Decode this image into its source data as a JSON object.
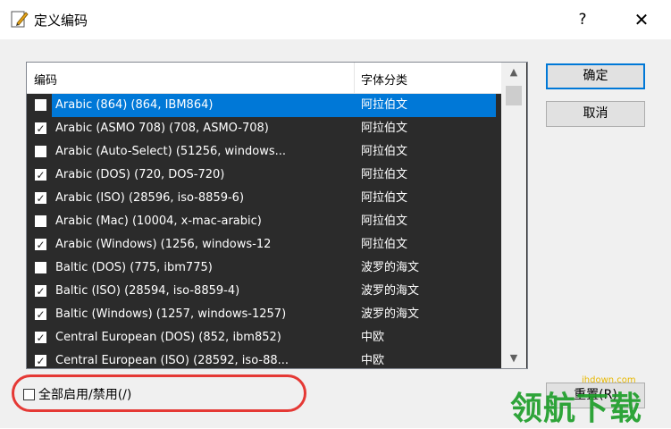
{
  "window": {
    "title": "定义编码",
    "help_label": "?",
    "close_label": "✕",
    "icon": "edit-document-icon"
  },
  "list": {
    "header": {
      "encoding": "编码",
      "category": "字体分类"
    },
    "rows": [
      {
        "label": "Arabic (864) (864, IBM864)",
        "category": "阿拉伯文",
        "checked": false,
        "selected": true
      },
      {
        "label": "Arabic (ASMO 708) (708, ASMO-708)",
        "category": "阿拉伯文",
        "checked": true,
        "selected": false
      },
      {
        "label": "Arabic (Auto-Select) (51256, windows...",
        "category": "阿拉伯文",
        "checked": false,
        "selected": false
      },
      {
        "label": "Arabic (DOS) (720, DOS-720)",
        "category": "阿拉伯文",
        "checked": true,
        "selected": false
      },
      {
        "label": "Arabic (ISO) (28596, iso-8859-6)",
        "category": "阿拉伯文",
        "checked": true,
        "selected": false
      },
      {
        "label": "Arabic (Mac) (10004, x-mac-arabic)",
        "category": "阿拉伯文",
        "checked": false,
        "selected": false
      },
      {
        "label": "Arabic (Windows) (1256, windows-12",
        "category": "阿拉伯文",
        "checked": true,
        "selected": false
      },
      {
        "label": "Baltic (DOS) (775, ibm775)",
        "category": "波罗的海文",
        "checked": false,
        "selected": false
      },
      {
        "label": "Baltic (ISO) (28594, iso-8859-4)",
        "category": "波罗的海文",
        "checked": true,
        "selected": false
      },
      {
        "label": "Baltic (Windows) (1257, windows-1257)",
        "category": "波罗的海文",
        "checked": true,
        "selected": false
      },
      {
        "label": "Central European (DOS) (852, ibm852)",
        "category": "中欧",
        "checked": true,
        "selected": false
      },
      {
        "label": "Central European (ISO) (28592, iso-88...",
        "category": "中欧",
        "checked": true,
        "selected": false
      }
    ],
    "scroll_up_icon": "chevron-up-icon",
    "scroll_down_icon": "chevron-down-icon"
  },
  "buttons": {
    "ok": "确定",
    "cancel": "取消",
    "reset": "重置(R)"
  },
  "toggle_all": {
    "label": "全部启用/禁用(/)",
    "checked": false
  },
  "watermark": {
    "url": "ihdown.com",
    "text": "领航下载"
  },
  "colors": {
    "selection": "#0078d7",
    "list_background": "#2b2b2b",
    "highlight_ring": "#e53935"
  }
}
